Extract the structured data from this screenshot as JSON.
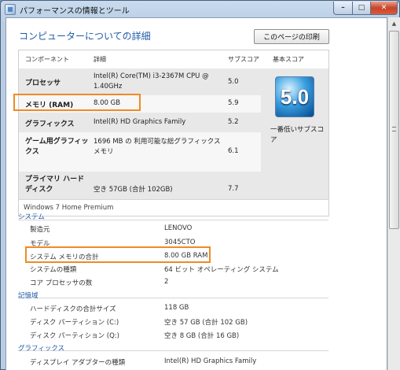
{
  "window": {
    "title": "パフォーマンスの情報とツール",
    "minimize": "–",
    "maximize": "□",
    "close": "✕"
  },
  "page": {
    "title": "コンピューターについての詳細",
    "print_label": "このページの印刷"
  },
  "table": {
    "headers": [
      "コンポーネント",
      "詳細",
      "サブスコア",
      "基本スコア"
    ],
    "rows": [
      {
        "label": "プロセッサ",
        "detail": "Intel(R) Core(TM) i3-2367M CPU @ 1.40GHz",
        "subscore": "5.0"
      },
      {
        "label": "メモリ (RAM)",
        "detail": "8.00 GB",
        "subscore": "5.9"
      },
      {
        "label": "グラフィックス",
        "detail": "Intel(R) HD Graphics Family",
        "subscore": "5.2"
      },
      {
        "label": "ゲーム用グラフィックス",
        "detail": "1696 MB の 利用可能な総グラフィックス メモリ",
        "subscore": "6.1"
      },
      {
        "label": "プライマリ ハード ディスク",
        "detail": "空き 57GB (合計 102GB)",
        "subscore": "7.7"
      }
    ],
    "base_score": "5.0",
    "base_score_note": "一番低いサブスコア",
    "os": "Windows 7 Home Premium"
  },
  "system": {
    "heading": "システム",
    "items": [
      {
        "label": "製造元",
        "value": "LENOVO"
      },
      {
        "label": "モデル",
        "value": "3045CTO"
      },
      {
        "label": "システム メモリの合計",
        "value": "8.00 GB RAM"
      },
      {
        "label": "システムの種類",
        "value": "64 ビット オペレーティング システム"
      },
      {
        "label": "コア プロセッサの数",
        "value": "2"
      }
    ]
  },
  "storage": {
    "heading": "記憶域",
    "items": [
      {
        "label": "ハードディスクの合計サイズ",
        "value": "118 GB"
      },
      {
        "label": "ディスク パーティション (C:)",
        "value": "空き 57 GB (合計 102 GB)"
      },
      {
        "label": "ディスク パーティション (Q:)",
        "value": "空き 8 GB (合計 16 GB)"
      }
    ]
  },
  "graphics": {
    "heading": "グラフィックス",
    "items": [
      {
        "label": "ディスプレイ アダプターの種類",
        "value": "Intel(R) HD Graphics Family"
      }
    ]
  },
  "colors": {
    "highlight": "#f08a24",
    "link": "#1e5aa8"
  }
}
